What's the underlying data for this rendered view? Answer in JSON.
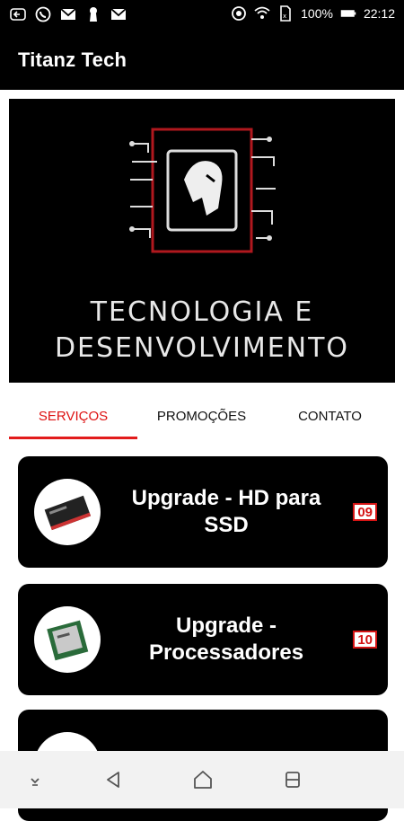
{
  "status_bar": {
    "battery": "100%",
    "time": "22:12",
    "icons_left": [
      "back-arrow-icon",
      "whatsapp-icon",
      "gmail-icon",
      "keyhole-icon",
      "gmail-icon"
    ],
    "icons_right": [
      "vpn-icon",
      "wifi-icon",
      "sim-icon",
      "battery-icon"
    ]
  },
  "app_bar": {
    "title": "Titanz Tech"
  },
  "banner": {
    "line1": "TECNOLOGIA E",
    "line2": "DESENVOLVIMENTO"
  },
  "tabs": [
    {
      "label": "SERVIÇOS",
      "active": true
    },
    {
      "label": "PROMOÇÕES",
      "active": false
    },
    {
      "label": "CONTATO",
      "active": false
    }
  ],
  "cards": [
    {
      "title": "Upgrade - HD para SSD",
      "badge": "09",
      "thumb": "ssd-image"
    },
    {
      "title": "Upgrade - Processadores",
      "badge": "10",
      "thumb": "processor-image"
    }
  ],
  "nav": [
    "hide-keyboard-icon",
    "back-triangle-icon",
    "home-icon",
    "recents-icon"
  ],
  "colors": {
    "accent": "#e21b1b",
    "card_bg": "#000000",
    "badge_text": "#d41414"
  }
}
